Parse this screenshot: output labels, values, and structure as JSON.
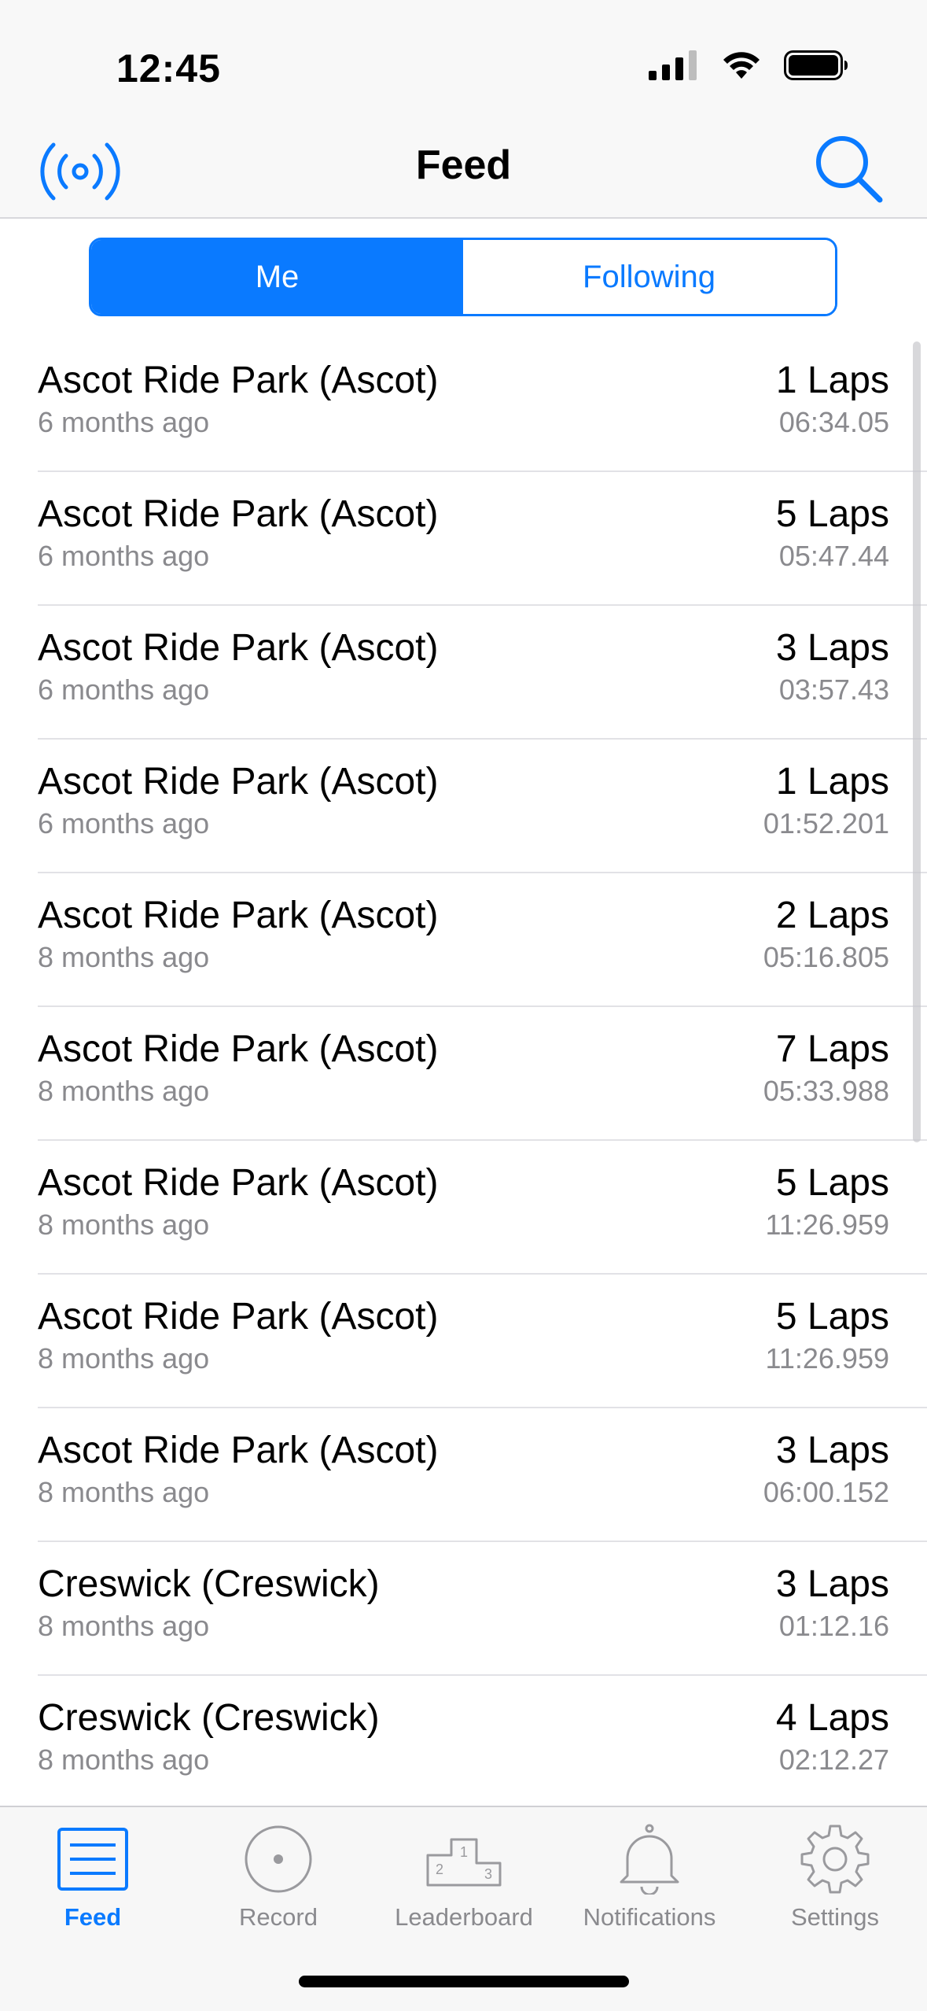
{
  "status_bar": {
    "time": "12:45"
  },
  "nav": {
    "title": "Feed",
    "left_icon": "broadcast-icon",
    "right_icon": "search-icon"
  },
  "segment": {
    "me_label": "Me",
    "following_label": "Following",
    "selected": "Me"
  },
  "feed": [
    {
      "title": "Ascot Ride Park (Ascot)",
      "ago": "6 months ago",
      "laps": "1 Laps",
      "time": "06:34.05"
    },
    {
      "title": "Ascot Ride Park (Ascot)",
      "ago": "6 months ago",
      "laps": "5 Laps",
      "time": "05:47.44"
    },
    {
      "title": "Ascot Ride Park (Ascot)",
      "ago": "6 months ago",
      "laps": "3 Laps",
      "time": "03:57.43"
    },
    {
      "title": "Ascot Ride Park (Ascot)",
      "ago": "6 months ago",
      "laps": "1 Laps",
      "time": "01:52.201"
    },
    {
      "title": "Ascot Ride Park (Ascot)",
      "ago": "8 months ago",
      "laps": "2 Laps",
      "time": "05:16.805"
    },
    {
      "title": "Ascot Ride Park (Ascot)",
      "ago": "8 months ago",
      "laps": "7 Laps",
      "time": "05:33.988"
    },
    {
      "title": "Ascot Ride Park (Ascot)",
      "ago": "8 months ago",
      "laps": "5 Laps",
      "time": "11:26.959"
    },
    {
      "title": "Ascot Ride Park (Ascot)",
      "ago": "8 months ago",
      "laps": "5 Laps",
      "time": "11:26.959"
    },
    {
      "title": "Ascot Ride Park (Ascot)",
      "ago": "8 months ago",
      "laps": "3 Laps",
      "time": "06:00.152"
    },
    {
      "title": "Creswick (Creswick)",
      "ago": "8 months ago",
      "laps": "3 Laps",
      "time": "01:12.16"
    },
    {
      "title": "Creswick (Creswick)",
      "ago": "8 months ago",
      "laps": "4 Laps",
      "time": "02:12.27"
    }
  ],
  "tabs": [
    {
      "label": "Feed",
      "icon": "feed-list-icon",
      "active": true
    },
    {
      "label": "Record",
      "icon": "record-icon",
      "active": false
    },
    {
      "label": "Leaderboard",
      "icon": "podium-icon",
      "active": false
    },
    {
      "label": "Notifications",
      "icon": "bell-icon",
      "active": false
    },
    {
      "label": "Settings",
      "icon": "gear-icon",
      "active": false
    }
  ],
  "colors": {
    "accent": "#0a7aff",
    "secondary_text": "#8a8a8e",
    "separator": "#e2e2e6"
  }
}
